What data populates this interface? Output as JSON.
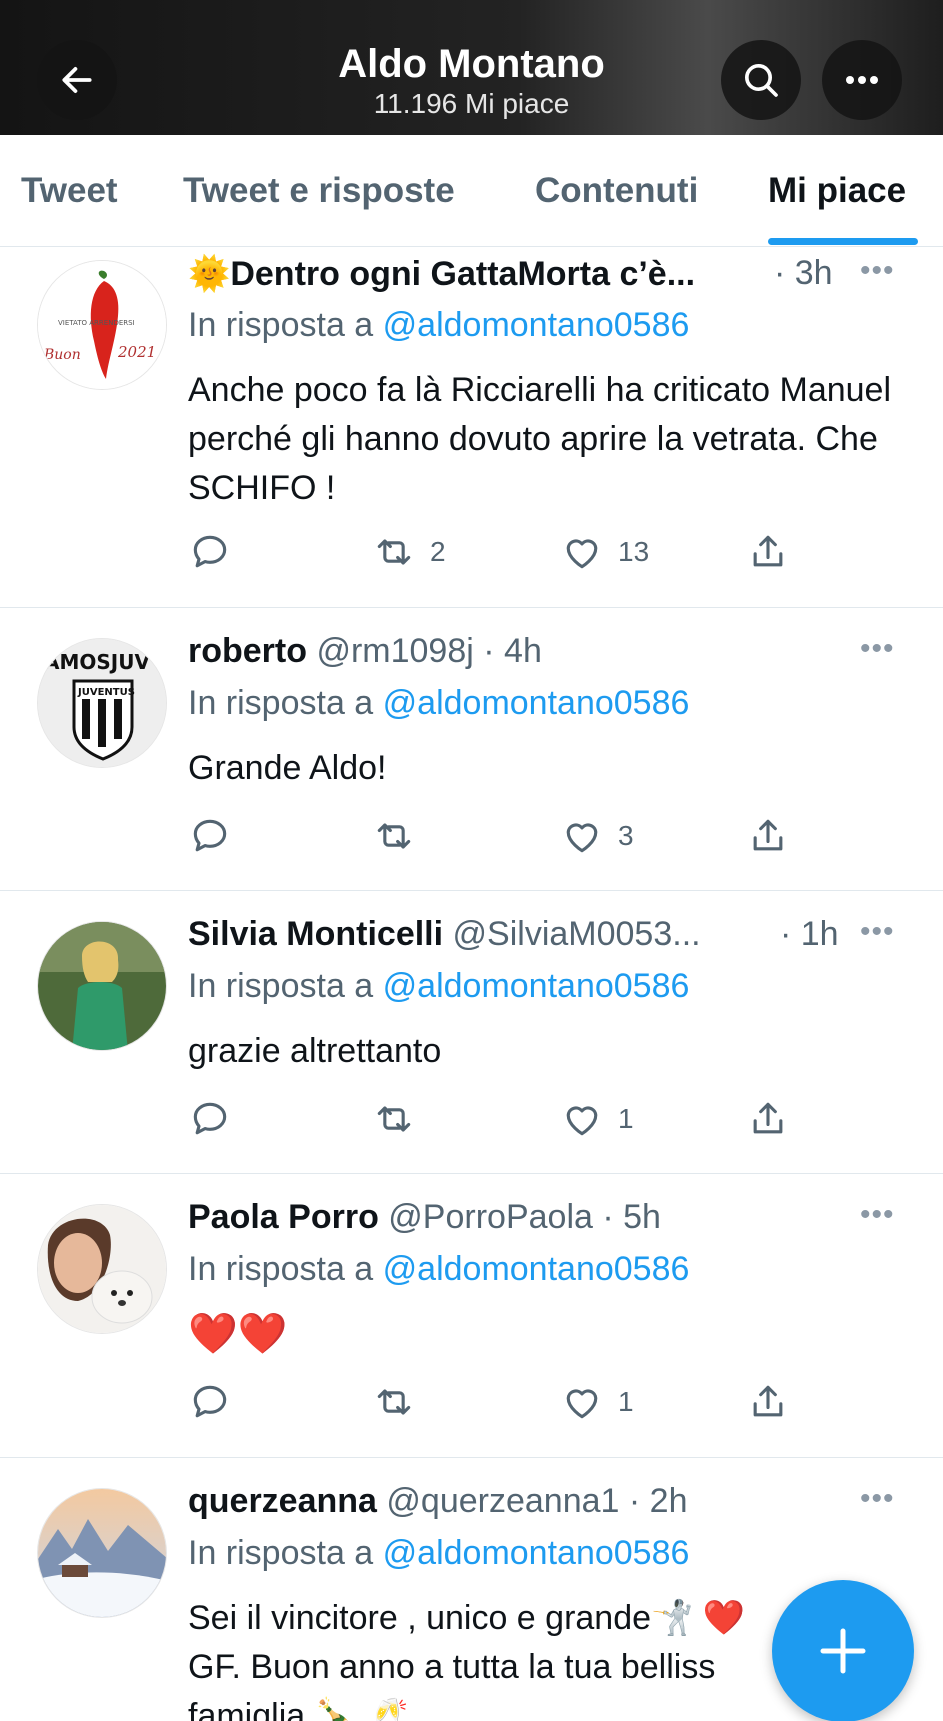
{
  "header": {
    "title": "Aldo Montano",
    "subtitle": "11.196 Mi piace",
    "back_icon": "arrow-left-icon",
    "search_icon": "search-icon",
    "more_icon": "more-horizontal-icon"
  },
  "tabs": [
    {
      "label": "Tweet"
    },
    {
      "label": "Tweet e risposte"
    },
    {
      "label": "Contenuti"
    },
    {
      "label": "Mi piace",
      "active": true
    }
  ],
  "colors": {
    "accent": "#1d9bf0",
    "secondary_text": "#536471",
    "primary_text": "#0f1419"
  },
  "tweets": [
    {
      "name": "Dentro ogni GattaMorta c’è...",
      "name_emoji": "🌞",
      "handle": "",
      "time": "· 3h",
      "reply_prefix": "In risposta a ",
      "reply_to": "@aldomontano0586",
      "text": "Anche poco fa là Ricciarelli ha criticato Manuel perché gli hanno dovuto aprire la vetrata. Che SCHIFO !",
      "retweets": "2",
      "likes": "13",
      "avatar_texts": {
        "a": "VIETATO ARRENDERSI",
        "b": "Buon",
        "c": "2021"
      }
    },
    {
      "name": "roberto",
      "handle": "@rm1098j",
      "time": "· 4h",
      "reply_prefix": "In risposta a ",
      "reply_to": "@aldomontano0586",
      "text": "Grande Aldo!",
      "retweets": "",
      "likes": "3",
      "avatar_texts": {
        "a": "AMOSJUV",
        "b": "JUVENTUS"
      }
    },
    {
      "name": "Silvia Monticelli",
      "handle": "@SilviaM0053...",
      "time": "· 1h",
      "reply_prefix": "In risposta a ",
      "reply_to": "@aldomontano0586",
      "text": "grazie altrettanto",
      "retweets": "",
      "likes": "1"
    },
    {
      "name": "Paola Porro",
      "handle": "@PorroPaola",
      "time": "· 5h",
      "reply_prefix": "In risposta a ",
      "reply_to": "@aldomontano0586",
      "text": "❤️❤️",
      "retweets": "",
      "likes": "1"
    },
    {
      "name": "querzeanna",
      "handle": "@querzeanna1",
      "time": "· 2h",
      "reply_prefix": "In risposta a ",
      "reply_to": "@aldomontano0586",
      "text": "Sei il vincitore , unico e grande🤺 ❤️ GF. Buon anno a tutta la tua belliss famiglia 🍾 🥂",
      "retweets": "",
      "likes": ""
    }
  ],
  "fab": {
    "icon": "plus-icon"
  }
}
